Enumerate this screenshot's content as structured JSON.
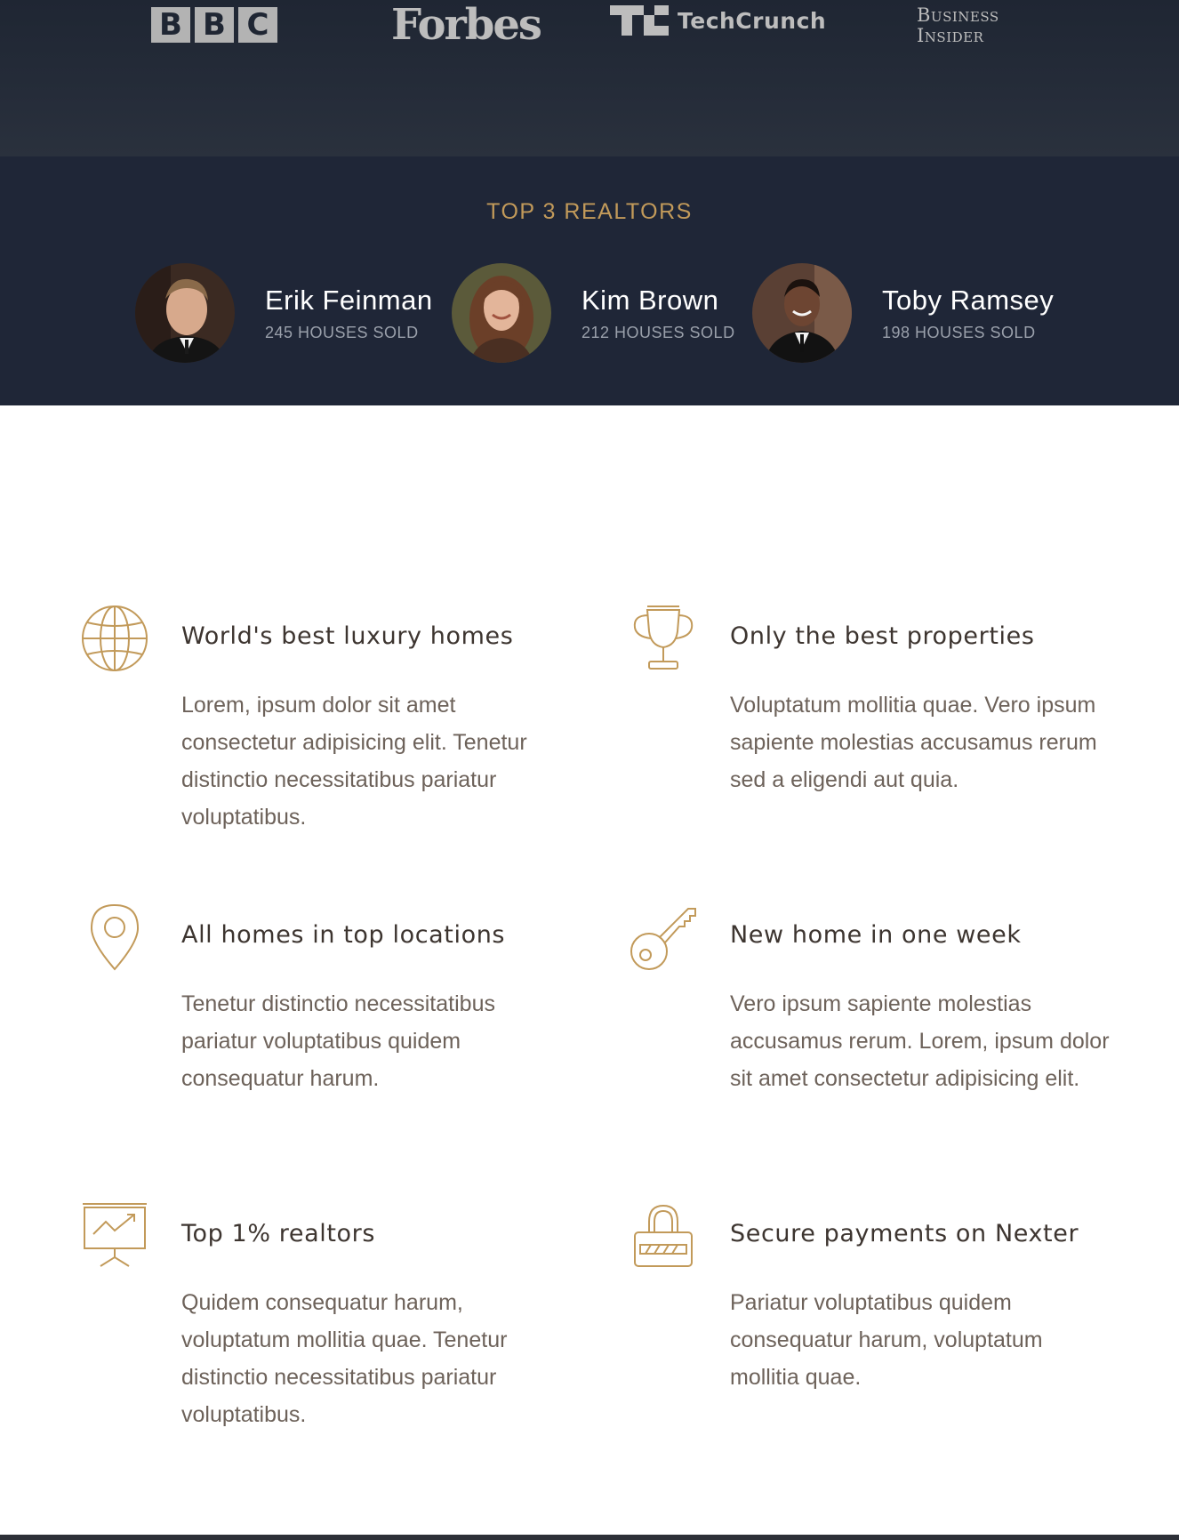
{
  "press": {
    "logos": [
      {
        "name": "BBC",
        "letters": [
          "B",
          "B",
          "C"
        ]
      },
      {
        "name": "Forbes",
        "text": "Forbes"
      },
      {
        "name": "TechCrunch",
        "text": "TechCrunch"
      },
      {
        "name": "Business Insider",
        "line1": "Business",
        "line2": "Insider"
      }
    ]
  },
  "realtors": {
    "heading": "TOP 3 REALTORS",
    "items": [
      {
        "name": "Erik Feinman",
        "sold": "245 HOUSES SOLD"
      },
      {
        "name": "Kim Brown",
        "sold": "212 HOUSES SOLD"
      },
      {
        "name": "Toby Ramsey",
        "sold": "198 HOUSES SOLD"
      }
    ]
  },
  "features": [
    {
      "icon": "globe-icon",
      "title": "World's best luxury homes",
      "text": "Lorem, ipsum dolor sit amet consectetur adipisicing elit. Tenetur distinctio necessitatibus pariatur voluptatibus."
    },
    {
      "icon": "trophy-icon",
      "title": "Only the best properties",
      "text": "Voluptatum mollitia quae. Vero ipsum sapiente molestias accusamus rerum sed a eligendi aut quia."
    },
    {
      "icon": "map-pin-icon",
      "title": "All homes in top locations",
      "text": "Tenetur distinctio necessitatibus pariatur voluptatibus quidem consequatur harum."
    },
    {
      "icon": "key-icon",
      "title": "New home in one week",
      "text": "Vero ipsum sapiente molestias accusamus rerum. Lorem, ipsum dolor sit amet consectetur adipisicing elit."
    },
    {
      "icon": "presentation-chart-icon",
      "title": "Top 1% realtors",
      "text": "Quidem consequatur harum, voluptatum mollitia quae. Tenetur distinctio necessitatibus pariatur voluptatibus."
    },
    {
      "icon": "lock-icon",
      "title": "Secure payments on Nexter",
      "text": "Pariatur voluptatibus quidem consequatur harum, voluptatum mollitia quae."
    }
  ],
  "colors": {
    "accent_gold": "#c29a5a",
    "dark_navy": "#1f2637",
    "heading_text": "#3d3530",
    "body_text": "#6d625a"
  }
}
